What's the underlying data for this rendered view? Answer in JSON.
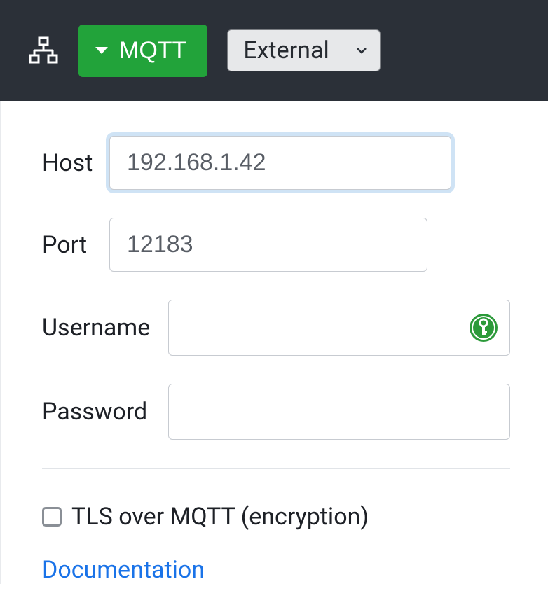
{
  "topbar": {
    "protocol_button_label": "MQTT",
    "scope_select_value": "External"
  },
  "form": {
    "host": {
      "label": "Host",
      "value": "192.168.1.42"
    },
    "port": {
      "label": "Port",
      "value": "12183"
    },
    "username": {
      "label": "Username",
      "value": ""
    },
    "password": {
      "label": "Password",
      "value": ""
    },
    "tls": {
      "label": "TLS over MQTT (encryption)",
      "checked": false
    }
  },
  "links": {
    "documentation": "Documentation"
  },
  "colors": {
    "topbar_bg": "#2b3038",
    "accent_green": "#22a33a",
    "link_blue": "#1a73e8"
  }
}
